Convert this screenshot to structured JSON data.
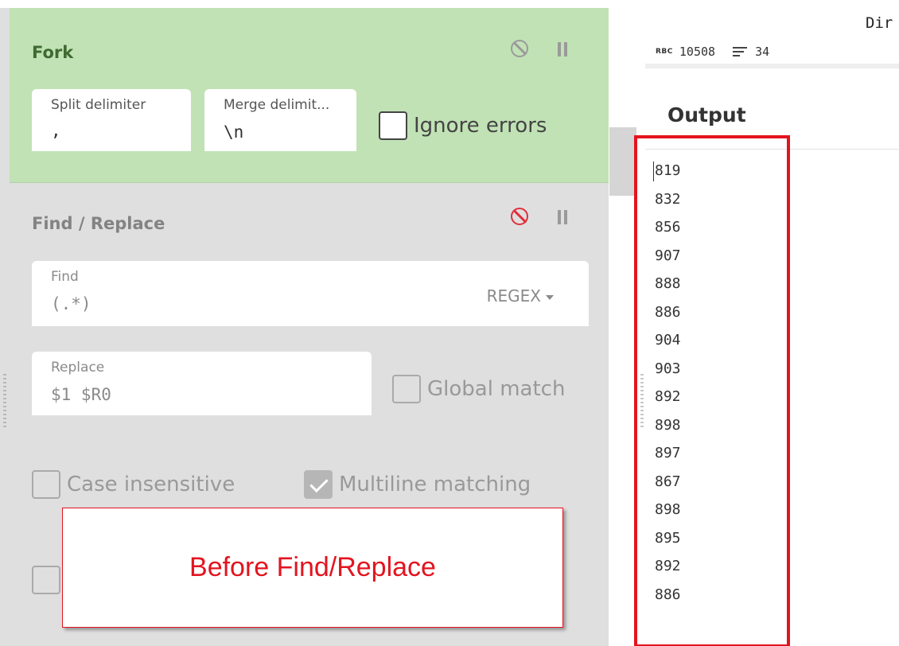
{
  "fork": {
    "title": "Fork",
    "split_delimiter": {
      "label": "Split delimiter",
      "value": ","
    },
    "merge_delimiter": {
      "label": "Merge delimit...",
      "value": "\\n"
    },
    "ignore_errors": {
      "label": "Ignore errors",
      "checked": false
    }
  },
  "find_replace": {
    "title": "Find / Replace",
    "find": {
      "label": "Find",
      "value": "(.*)"
    },
    "find_mode": "REGEX",
    "replace": {
      "label": "Replace",
      "value": "$1 $R0"
    },
    "global_match": {
      "label": "Global match",
      "checked": false
    },
    "case_insensitive": {
      "label": "Case insensitive",
      "checked": false
    },
    "multiline_matching": {
      "label": "Multiline matching",
      "checked": true
    }
  },
  "annotation": {
    "text": "Before Find/Replace",
    "color": "#e3141f"
  },
  "input_stats": {
    "dir_text": "Dir",
    "abc_icon": "RBC",
    "chars": "10508",
    "lines": "34"
  },
  "output": {
    "title": "Output",
    "lines": [
      "819",
      "832",
      "856",
      "907",
      "888",
      "886",
      "904",
      "903",
      "892",
      "898",
      "897",
      "867",
      "898",
      "895",
      "892",
      "886"
    ]
  },
  "colors": {
    "fork_bg": "#c1e2b5",
    "disabled_bg": "#dfdfdf",
    "highlight": "#e3141f"
  }
}
